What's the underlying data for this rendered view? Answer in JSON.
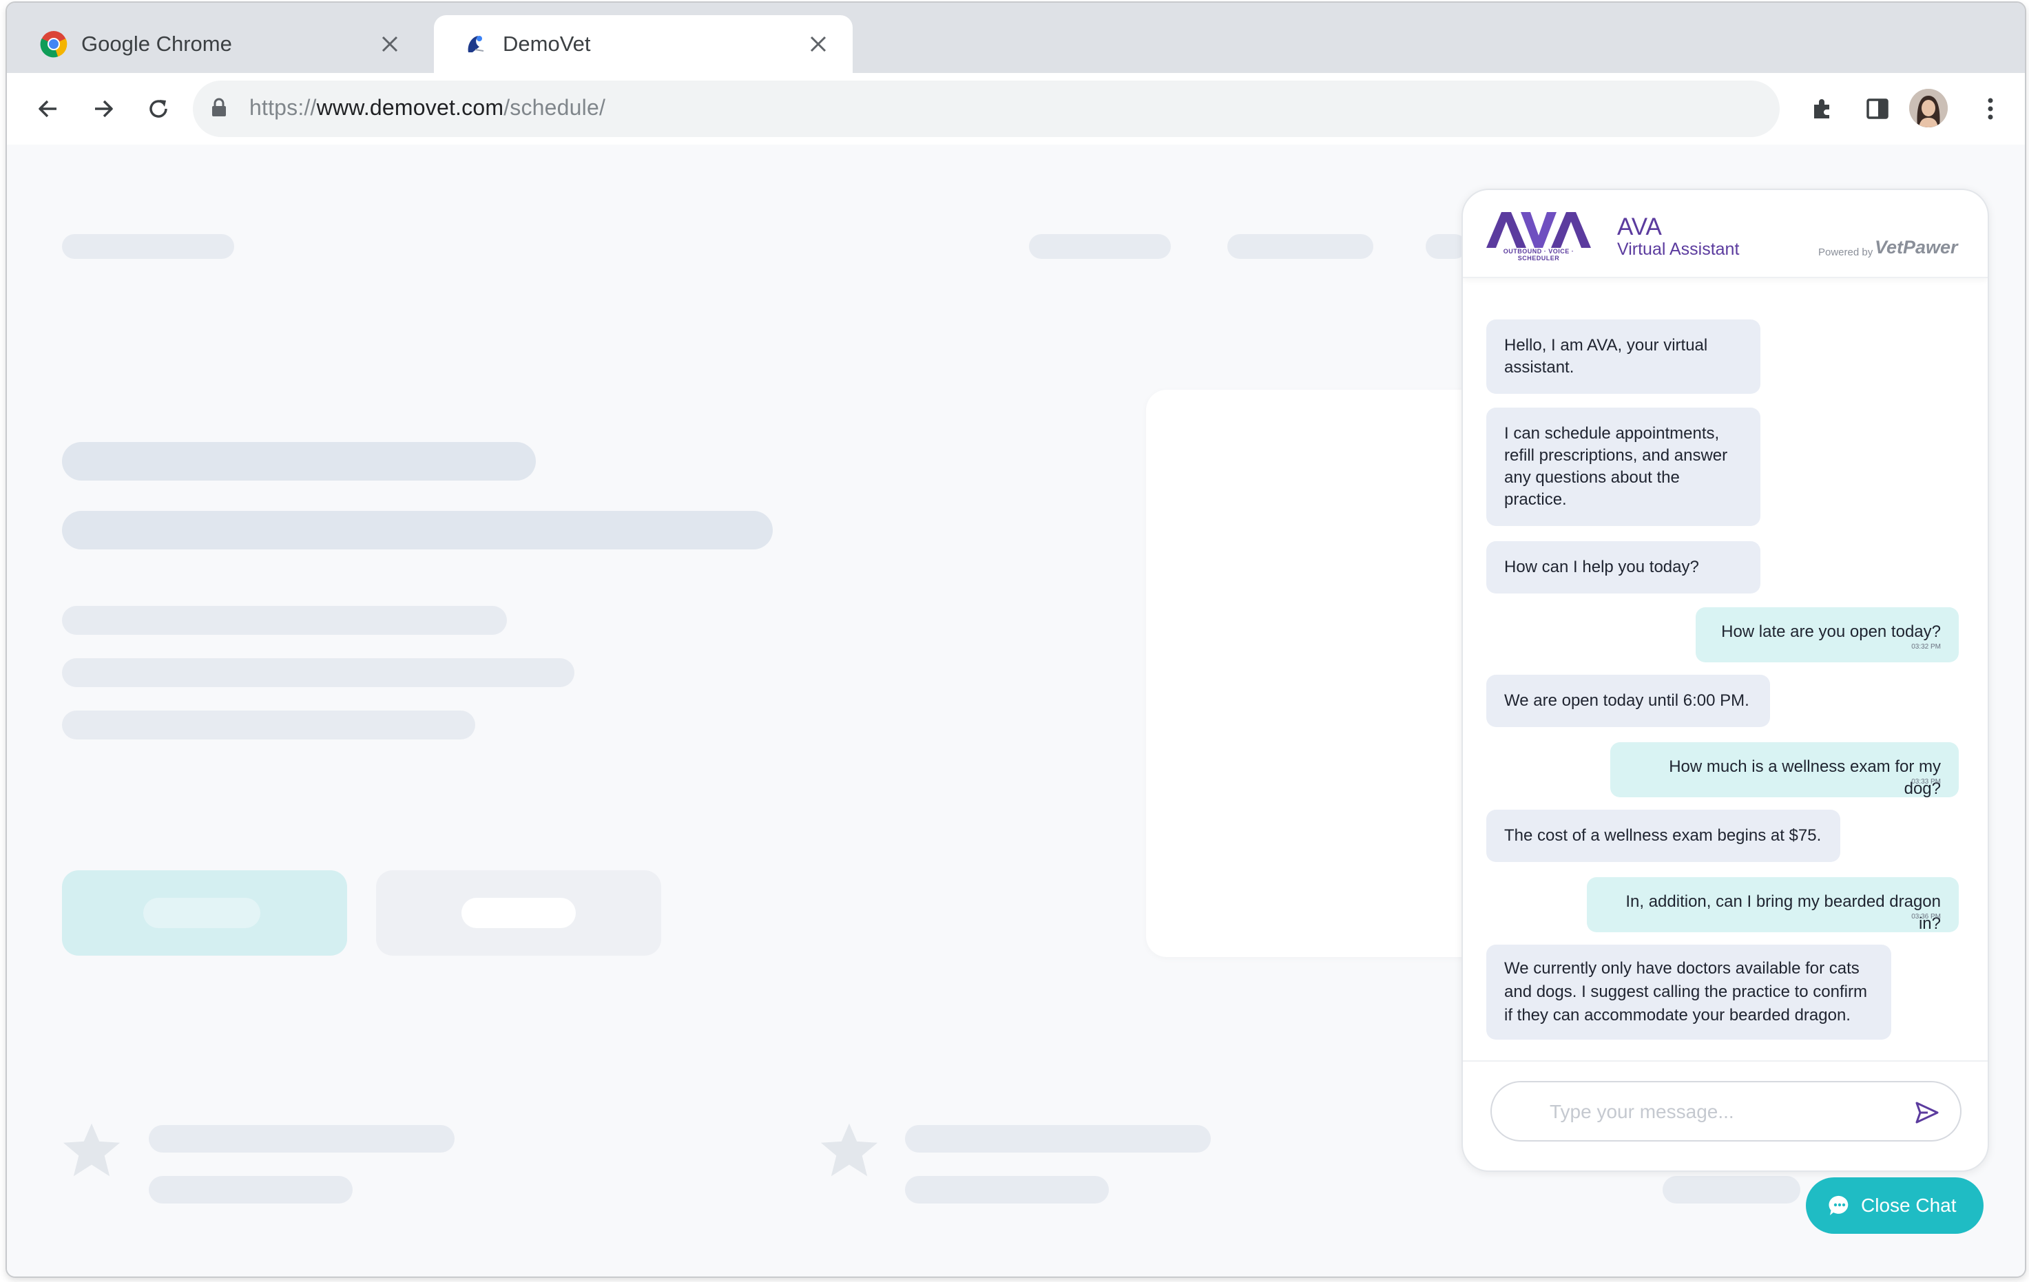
{
  "browser": {
    "tabs": [
      {
        "title": "Google Chrome",
        "icon": "chrome-icon",
        "active": false
      },
      {
        "title": "DemoVet",
        "icon": "demovet-favicon",
        "active": true
      }
    ],
    "url": {
      "scheme": "https://",
      "host": "www.demovet.com",
      "path": "/schedule/"
    },
    "toolbar_icons": [
      "back-icon",
      "forward-icon",
      "reload-icon",
      "lock-icon",
      "extensions-icon",
      "side-panel-icon",
      "profile-avatar",
      "menu-icon"
    ]
  },
  "chat": {
    "logo_text": "AVA",
    "logo_subtitle": "OUTBOUND · VOICE · SCHEDULER",
    "name": "AVA",
    "subtitle": "Virtual Assistant",
    "powered_by": "Powered by",
    "powered_brand": "VetPawer",
    "messages": [
      {
        "from": "bot",
        "text": "Hello, I am AVA, your virtual assistant."
      },
      {
        "from": "bot",
        "text": "I can schedule appointments, refill prescriptions, and answer any questions about the practice."
      },
      {
        "from": "bot",
        "text": "How can I help you today?"
      },
      {
        "from": "user",
        "text": "How late are you open today?",
        "time": "03:32 PM"
      },
      {
        "from": "bot",
        "text": "We are open today until 6:00 PM."
      },
      {
        "from": "user",
        "text": "How much is a wellness exam for my dog?",
        "time": "03:33 PM"
      },
      {
        "from": "bot",
        "text": "The cost of a wellness exam begins at $75."
      },
      {
        "from": "user",
        "text": "In, addition, can I bring my bearded dragon in?",
        "time": "03:36 PM"
      },
      {
        "from": "bot",
        "text": "We currently only have doctors available for cats and dogs. I suggest calling the practice to confirm if they can accommodate your bearded dragon."
      }
    ],
    "input_placeholder": "Type your message...",
    "close_label": "Close Chat"
  },
  "colors": {
    "accent_teal": "#1fbcc4",
    "brand_purple": "#5b3b9e",
    "bot_bubble": "#e9edf5",
    "user_bubble": "#d9f3f3"
  }
}
